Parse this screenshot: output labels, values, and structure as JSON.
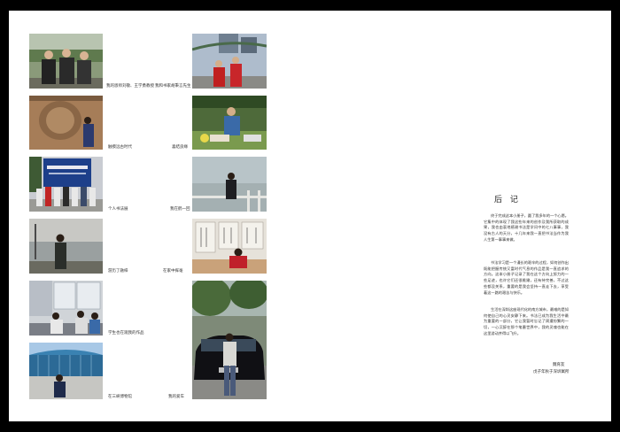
{
  "left_page": {
    "captions": [
      "我的恩师刘敬、王学勇教授",
      "我和书家胡秉言先生",
      "触摸远古时代",
      "喜结良缘",
      "个人书法展",
      "我在鹤一回",
      "游历了融梓",
      "在家中挥毫",
      "学生也在观我的作品",
      "在三峡博物馆",
      "我的爱车"
    ],
    "photo_names": [
      "teachers-group-photo",
      "with-calligrapher-photo",
      "stone-carving-photo",
      "wedding-photo",
      "exhibition-group-photo",
      "railing-photo",
      "riverside-photo",
      "home-calligraphy-photo",
      "students-photo",
      "museum-photo",
      "car-photo"
    ]
  },
  "right_page": {
    "title": "后 记",
    "paragraphs": [
      "终于完成这本小册子，圆了我多年的一个心愿。它集中的体现了我这些年来的创作及我所获取的成果，我也由衷地感谢书法是学问中的七八事事，我没有古人的天分，十几年来我一直把书法当作为我人生第一事事来做。",
      "书法学习是一个漫长的艰辛的过程，如何创作出既能把握传统又富时代气息的作品是我一直追求的方向。这本小册子记录了我在这个方向上努力的一些足迹，也许它们还很稚嫩，还有待完善，不过这些都没关系，重要的是我会坚持一直走下去，享受着这一路的艰苦与快乐。",
      "生活在深圳这座现代化的南方城市，最难的是如何使自己的心灵安静下来。书法已成为我生活中最为重要的一部分，它让我暂时忘记了周遭纷繁的一切，一心沉醉在那个笔墨世界中，我的灵魂也能在这里游动并得以飞升。"
    ],
    "author": "魏育友",
    "signature_line": "戊子年秋于深圳寓所"
  }
}
